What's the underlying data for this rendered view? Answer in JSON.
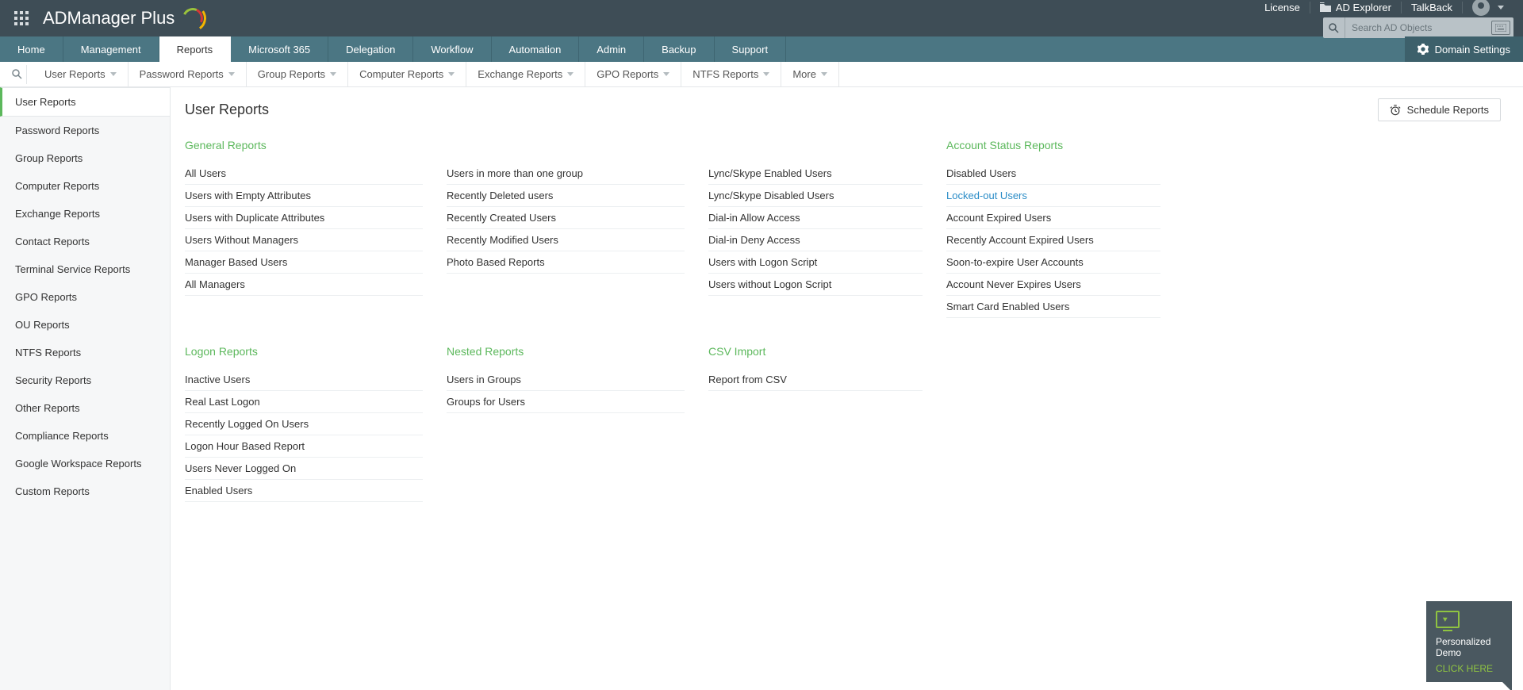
{
  "branding": {
    "name": "ADManager Plus"
  },
  "topbar": {
    "links": {
      "license": "License",
      "ad_explorer": "AD Explorer",
      "talkback": "TalkBack"
    },
    "search_placeholder": "Search AD Objects"
  },
  "mainnav": {
    "items": [
      "Home",
      "Management",
      "Reports",
      "Microsoft 365",
      "Delegation",
      "Workflow",
      "Automation",
      "Admin",
      "Backup",
      "Support"
    ],
    "active": "Reports",
    "domain_settings": "Domain Settings"
  },
  "subnav": {
    "items": [
      "User Reports",
      "Password Reports",
      "Group Reports",
      "Computer Reports",
      "Exchange Reports",
      "GPO Reports",
      "NTFS Reports",
      "More"
    ]
  },
  "sidebar": {
    "items": [
      "User Reports",
      "Password Reports",
      "Group Reports",
      "Computer Reports",
      "Exchange Reports",
      "Contact Reports",
      "Terminal Service Reports",
      "GPO Reports",
      "OU Reports",
      "NTFS Reports",
      "Security Reports",
      "Other Reports",
      "Compliance Reports",
      "Google Workspace Reports",
      "Custom Reports"
    ],
    "active": "User Reports"
  },
  "page": {
    "title": "User Reports",
    "schedule_button": "Schedule Reports"
  },
  "report_groups_row1": {
    "general": {
      "title": "General Reports",
      "col1": [
        "All Users",
        "Users with Empty Attributes",
        "Users with Duplicate Attributes",
        "Users Without Managers",
        "Manager Based Users",
        "All Managers"
      ],
      "col2": [
        "Users in more than one group",
        "Recently Deleted users",
        "Recently Created Users",
        "Recently Modified Users",
        "Photo Based Reports"
      ],
      "col3": [
        "Lync/Skype Enabled Users",
        "Lync/Skype Disabled Users",
        "Dial-in Allow Access",
        "Dial-in Deny Access",
        "Users with Logon Script",
        "Users without Logon Script"
      ]
    },
    "account_status": {
      "title": "Account Status Reports",
      "items": [
        "Disabled Users",
        "Locked-out Users",
        "Account Expired Users",
        "Recently Account Expired Users",
        "Soon-to-expire User Accounts",
        "Account Never Expires Users",
        "Smart Card Enabled Users"
      ],
      "highlighted": "Locked-out Users"
    }
  },
  "report_groups_row2": {
    "logon": {
      "title": "Logon Reports",
      "items": [
        "Inactive Users",
        "Real Last Logon",
        "Recently Logged On Users",
        "Logon Hour Based Report",
        "Users Never Logged On",
        "Enabled Users"
      ]
    },
    "nested": {
      "title": "Nested Reports",
      "items": [
        "Users in Groups",
        "Groups for Users"
      ]
    },
    "csv": {
      "title": "CSV Import",
      "items": [
        "Report from CSV"
      ]
    }
  },
  "demo_card": {
    "line1": "Personalized",
    "line2": "Demo",
    "cta": "CLICK HERE"
  }
}
